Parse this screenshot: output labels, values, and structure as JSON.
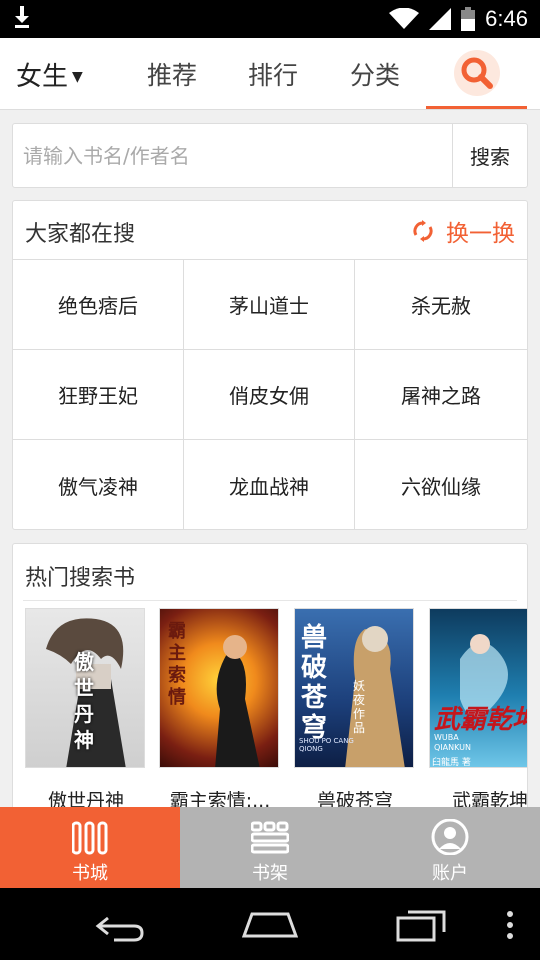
{
  "status_bar": {
    "time": "6:46"
  },
  "top_nav": {
    "gender": "女生",
    "tabs": [
      "推荐",
      "排行",
      "分类"
    ]
  },
  "search": {
    "placeholder": "请输入书名/作者名",
    "button": "搜索"
  },
  "hot_searches": {
    "title": "大家都在搜",
    "refresh": "换一换",
    "items": [
      "绝色痞后",
      "茅山道士",
      "杀无赦",
      "狂野王妃",
      "俏皮女佣",
      "屠神之路",
      "傲气凌神",
      "龙血战神",
      "六欲仙缘"
    ]
  },
  "hot_books": {
    "title": "热门搜索书",
    "books": [
      {
        "name": "傲世丹神",
        "cover_text": "傲世丹神"
      },
      {
        "name": "霸主索情:...",
        "cover_text": "霸主索情"
      },
      {
        "name": "兽破苍穹",
        "cover_text": "兽破苍穹",
        "cover_sub": "妖夜作品",
        "cover_pinyin": "SHOU PO CANG QIONG"
      },
      {
        "name": "武霸乾坤",
        "cover_text": "武霸乾坤",
        "cover_pinyin": "WUBA QIANKUN",
        "cover_author": "臼龍馬 著"
      }
    ]
  },
  "bottom_tabs": [
    {
      "label": "书城",
      "icon": "bookstore-icon",
      "active": true
    },
    {
      "label": "书架",
      "icon": "bookshelf-icon",
      "active": false
    },
    {
      "label": "账户",
      "icon": "account-icon",
      "active": false
    }
  ],
  "colors": {
    "accent": "#f26134",
    "tab_inactive_bg": "#b3b3b3"
  }
}
